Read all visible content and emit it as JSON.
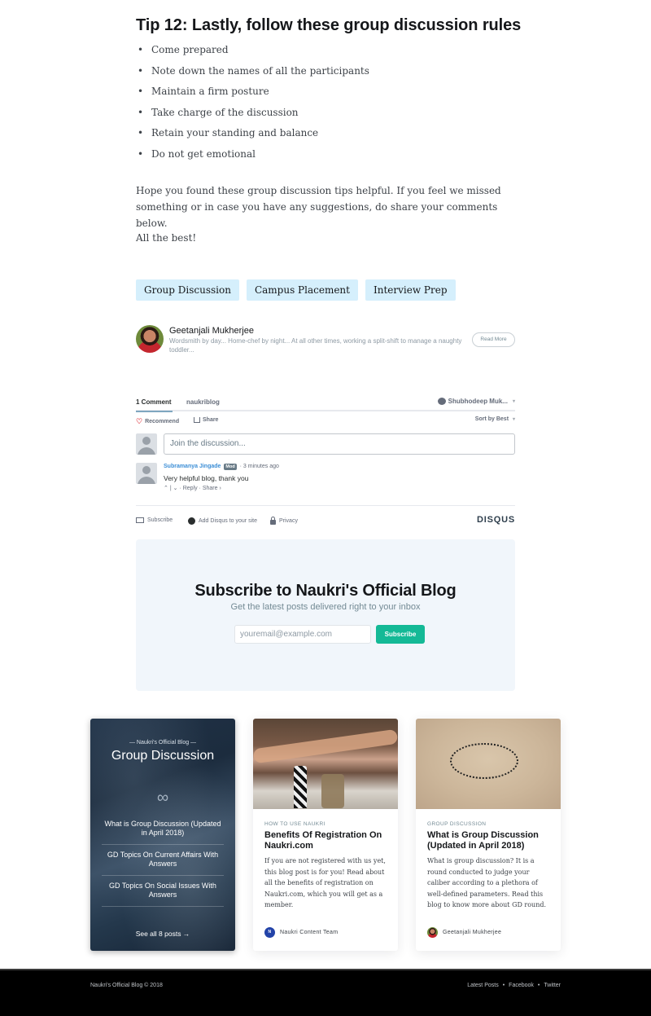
{
  "article": {
    "tip_heading": "Tip 12: Lastly, follow these group discussion rules",
    "rules": [
      "Come prepared",
      "Note down the names of all the participants",
      "Maintain a firm posture",
      "Take charge of the discussion",
      "Retain your standing and balance",
      "Do not get emotional"
    ],
    "closing_paragraph": "Hope you found these group discussion tips helpful. If you feel we missed something or in case you have any suggestions, do share your comments below.",
    "signoff": "All the best!"
  },
  "tags": [
    "Group Discussion",
    "Campus Placement",
    "Interview Prep"
  ],
  "author": {
    "name": "Geetanjali Mukherjee",
    "bio": "Wordsmith by day... Home-chef by night... At all other times, working a split-shift to manage a naughty toddler...",
    "read_more_label": "Read More"
  },
  "disqus": {
    "tab_comments": "1 Comment",
    "tab_forum": "naukriblog",
    "user_name": "Shubhodeep Muk...",
    "recommend_label": "Recommend",
    "share_label": "Share",
    "sort_label": "Sort by Best",
    "join_placeholder": "Join the discussion...",
    "comments": [
      {
        "author": "Subramanya Jingade",
        "badge": "Mod",
        "time": "· 3 minutes ago",
        "text": "Very helpful blog, thank you",
        "vote_up": "^",
        "vote_down": "v",
        "reply_label": "Reply",
        "share_label": "Share ›"
      }
    ],
    "footer": {
      "subscribe_label": "Subscribe",
      "add_disqus_label": "Add Disqus to your site",
      "privacy_label": "Privacy",
      "logo": "DISQUS"
    }
  },
  "subscribe": {
    "title": "Subscribe to Naukri's Official Blog",
    "description": "Get the latest posts delivered right to your inbox",
    "email_placeholder": "youremail@example.com",
    "button_label": "Subscribe"
  },
  "related": {
    "series": {
      "kicker": "— Naukri's Official Blog —",
      "title": "Group Discussion",
      "icon": "infinity-icon",
      "posts": [
        "What is Group Discussion (Updated in April 2018)",
        "GD Topics On Current Affairs With Answers",
        "GD Topics On Social Issues With Answers"
      ],
      "see_all": "See all 8 posts →"
    },
    "cards": [
      {
        "tag": "HOW TO USE NAUKRI",
        "title": "Benefits Of Registration On Naukri.com",
        "excerpt": "If you are not registered with us yet, this blog post is for you! Read about all the benefits of registration on Naukri.com, which you will get as a member.",
        "author": "Naukri Content Team",
        "author_initial": "N"
      },
      {
        "tag": "GROUP DISCUSSION",
        "title": "What is Group Discussion (Updated in April 2018)",
        "excerpt": "What is group discussion? It is a round conducted to judge your caliber according to a plethora of well-defined parameters. Read this blog to know more about GD round.",
        "author": "Geetanjali Mukherjee"
      }
    ]
  },
  "footer": {
    "copyright": "Naukri's Official Blog © 2018",
    "links": [
      "Latest Posts",
      "Facebook",
      "Twitter"
    ],
    "separator": "•"
  },
  "colors": {
    "tag_bg": "#d5effc",
    "subscribe_bg": "#f1f6fb",
    "subscribe_button": "#14b996",
    "footer_bg": "#000000"
  }
}
